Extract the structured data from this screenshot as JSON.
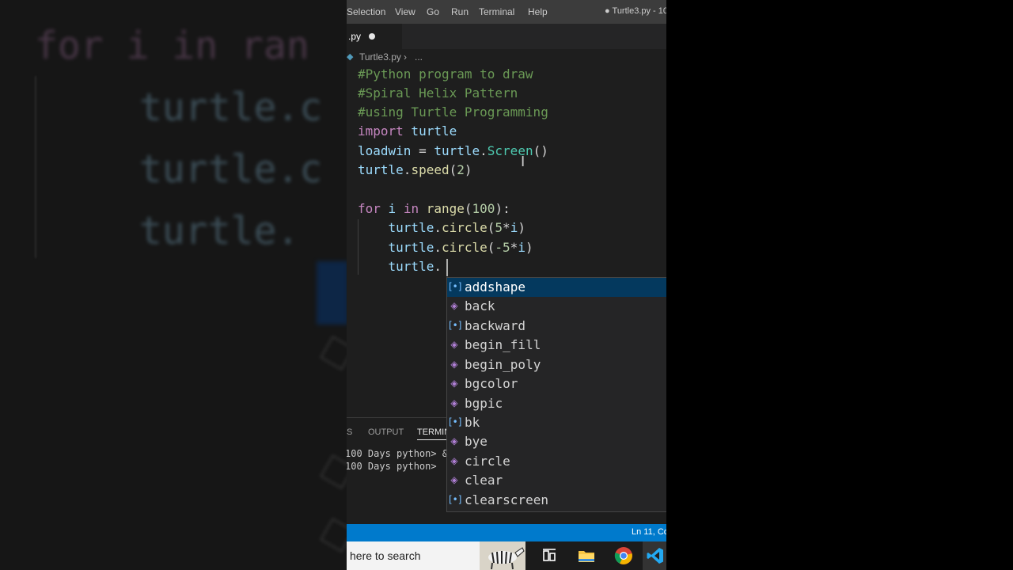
{
  "menubar": {
    "items": [
      "Selection",
      "View",
      "Go",
      "Run",
      "Terminal",
      "Help"
    ],
    "window_title": "● Turtle3.py - 10"
  },
  "tab": {
    "label": ".py"
  },
  "breadcrumb": {
    "file": "Turtle3.py",
    "separator": "›",
    "more": "..."
  },
  "editor": {
    "lines": [
      [
        "#Python program to draw"
      ],
      [
        "#Spiral Helix Pattern"
      ],
      [
        "#using Turtle Programming"
      ],
      [
        "import",
        " turtle"
      ],
      [
        "loadwin",
        " = ",
        "turtle",
        ".",
        "Screen",
        "()"
      ],
      [
        "turtle",
        ".",
        "speed",
        "(",
        "2",
        ")"
      ],
      [],
      [
        "for",
        " i ",
        "in",
        " ",
        "range",
        "(",
        "100",
        "):"
      ],
      [
        "    turtle",
        ".",
        "circle",
        "(",
        "5",
        "*",
        "i",
        ")"
      ],
      [
        "    turtle",
        ".",
        "circle",
        "(",
        "-5",
        "*",
        "i",
        ")"
      ],
      [
        "    turtle",
        "."
      ]
    ]
  },
  "suggestions": [
    {
      "label": "addshape",
      "icon": "variable"
    },
    {
      "label": "back",
      "icon": "method"
    },
    {
      "label": "backward",
      "icon": "variable"
    },
    {
      "label": "begin_fill",
      "icon": "method"
    },
    {
      "label": "begin_poly",
      "icon": "method"
    },
    {
      "label": "bgcolor",
      "icon": "method"
    },
    {
      "label": "bgpic",
      "icon": "method"
    },
    {
      "label": "bk",
      "icon": "variable"
    },
    {
      "label": "bye",
      "icon": "method"
    },
    {
      "label": "circle",
      "icon": "method"
    },
    {
      "label": "clear",
      "icon": "method"
    },
    {
      "label": "clearscreen",
      "icon": "variable"
    }
  ],
  "panel": {
    "tabs": [
      "S",
      "OUTPUT",
      "TERMIN"
    ],
    "terminal_lines": [
      "100 Days python> &",
      "100 Days python> "
    ]
  },
  "statusbar": {
    "position": "Ln 11, Co"
  },
  "taskbar": {
    "search_text": "here to search"
  },
  "background": {
    "blurred_lines": [
      "for i in ran",
      "turtle.c",
      "turtle.c",
      "turtle."
    ]
  },
  "colors": {
    "comment": "#6a9955",
    "keyword": "#c586c0",
    "variable": "#9cdcfe",
    "function": "#dcdcaa",
    "number": "#b5cea8",
    "accent": "#007acc",
    "selection": "#04395e"
  }
}
